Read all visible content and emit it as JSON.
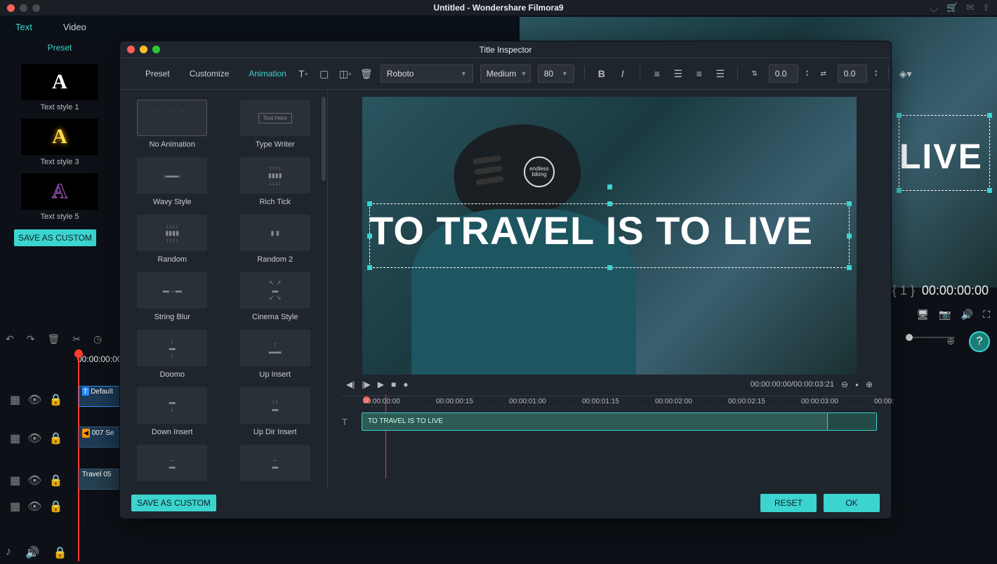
{
  "app": {
    "title": "Untitled - Wondershare Filmora9"
  },
  "main_tabs": {
    "text": "Text",
    "video": "Video"
  },
  "side": {
    "preset": "Preset",
    "styles": [
      {
        "letter": "A",
        "label": "Text style 1",
        "cls": "s1"
      },
      {
        "letter": "A",
        "label": "Text style 3",
        "cls": "s3"
      },
      {
        "letter": "A",
        "label": "Text style 5",
        "cls": "s5"
      }
    ],
    "save_custom": "SAVE AS CUSTOM"
  },
  "left_timeline": {
    "timecode": "00:00:00:00",
    "clip1": "Default",
    "clip2": "007 Se",
    "clip3": "Travel 05"
  },
  "preview": {
    "text": "LIVE",
    "timecode": "00:00:00:00",
    "marker": "1"
  },
  "dlg": {
    "title": "Title Inspector",
    "tabs": {
      "preset": "Preset",
      "customize": "Customize",
      "animation": "Animation"
    },
    "toolbar": {
      "font": "Roboto",
      "weight": "Medium",
      "size": "80",
      "lh": "0.0",
      "ls": "0.0"
    },
    "animations": [
      "No Animation",
      "Type Writer",
      "Wavy Style",
      "Rich Tick",
      "Random",
      "Random 2",
      "String Blur",
      "Cinema Style",
      "Doomo",
      "Up Insert",
      "Down Insert",
      "Up Dir Insert"
    ],
    "anim_hint": "Text Here",
    "canvas_text": "TO TRAVEL IS TO LIVE",
    "helmet_badge": "endless biking",
    "play_time": "00:00:00:00/00:00:03:21",
    "ruler": [
      "00:00:00:00",
      "00:00:00:15",
      "00:00:01:00",
      "00:00:01:15",
      "00:00:02:00",
      "00:00:02:15",
      "00:00:03:00",
      "00:00:"
    ],
    "clip_label": "TO TRAVEL IS TO LIVE",
    "save_custom": "SAVE AS CUSTOM",
    "reset": "RESET",
    "ok": "OK"
  }
}
